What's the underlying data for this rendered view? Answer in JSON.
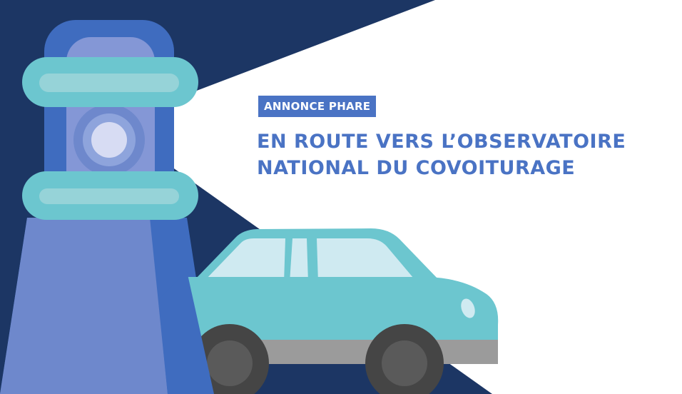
{
  "badge": {
    "label": "ANNONCE PHARE"
  },
  "headline": {
    "line1": "EN ROUTE VERS L’OBSERVATOIRE",
    "line2": "NATIONAL DU COVOITURAGE"
  },
  "colors": {
    "navy": "#1c3664",
    "blue": "#3f6cbf",
    "lavender": "#6e88cc",
    "lavender_light": "#8497d6",
    "teal": "#6cc6cf",
    "teal_light": "#96d3d8",
    "glass": "#cfeaf1",
    "tire": "#454545",
    "hubcap": "#5a5a5a",
    "bumper": "#9b9b9b",
    "badge_bg": "#4a73c4",
    "headline": "#4a73c4",
    "white": "#ffffff"
  },
  "icons": [
    "lighthouse-icon",
    "car-icon",
    "light-beam"
  ]
}
